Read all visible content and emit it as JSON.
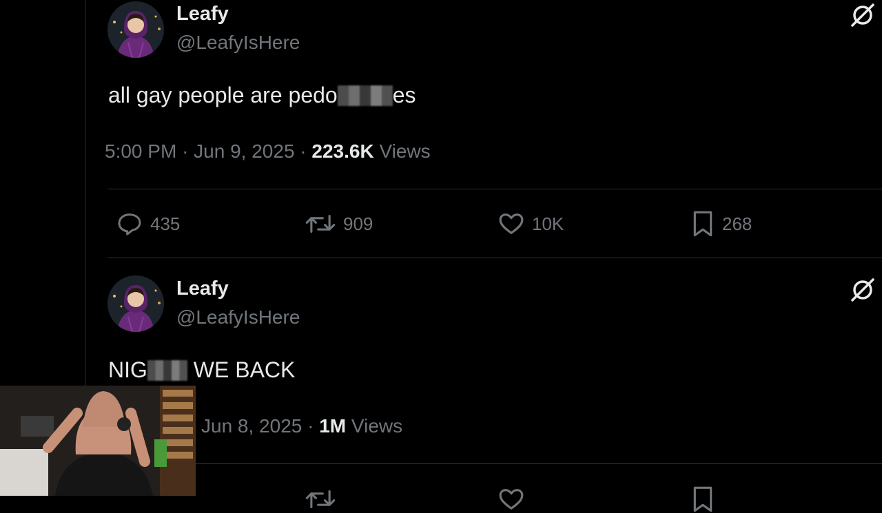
{
  "tweets": [
    {
      "name": "Leafy",
      "handle": "@LeafyIsHere",
      "text_before": "all gay people are pedo",
      "text_after": "es",
      "time": "5:00 PM",
      "sep": "·",
      "date": "Jun 9, 2025",
      "views_count": "223.6K",
      "views_label": "Views",
      "replies": "435",
      "retweets": "909",
      "likes": "10K",
      "bookmarks": "268"
    },
    {
      "name": "Leafy",
      "handle": "@LeafyIsHere",
      "text_before": "NIG",
      "text_after": " WE BACK",
      "date": "Jun 8, 2025",
      "sep": "·",
      "views_count": "1M",
      "views_label": "Views"
    }
  ],
  "icons": {
    "reply": "reply-icon",
    "retweet": "retweet-icon",
    "like": "heart-icon",
    "bookmark": "bookmark-icon",
    "grok": "grok-icon"
  },
  "colors": {
    "background": "#000000",
    "text": "#e7e9ea",
    "muted": "#71767b",
    "border": "#2f3336"
  }
}
